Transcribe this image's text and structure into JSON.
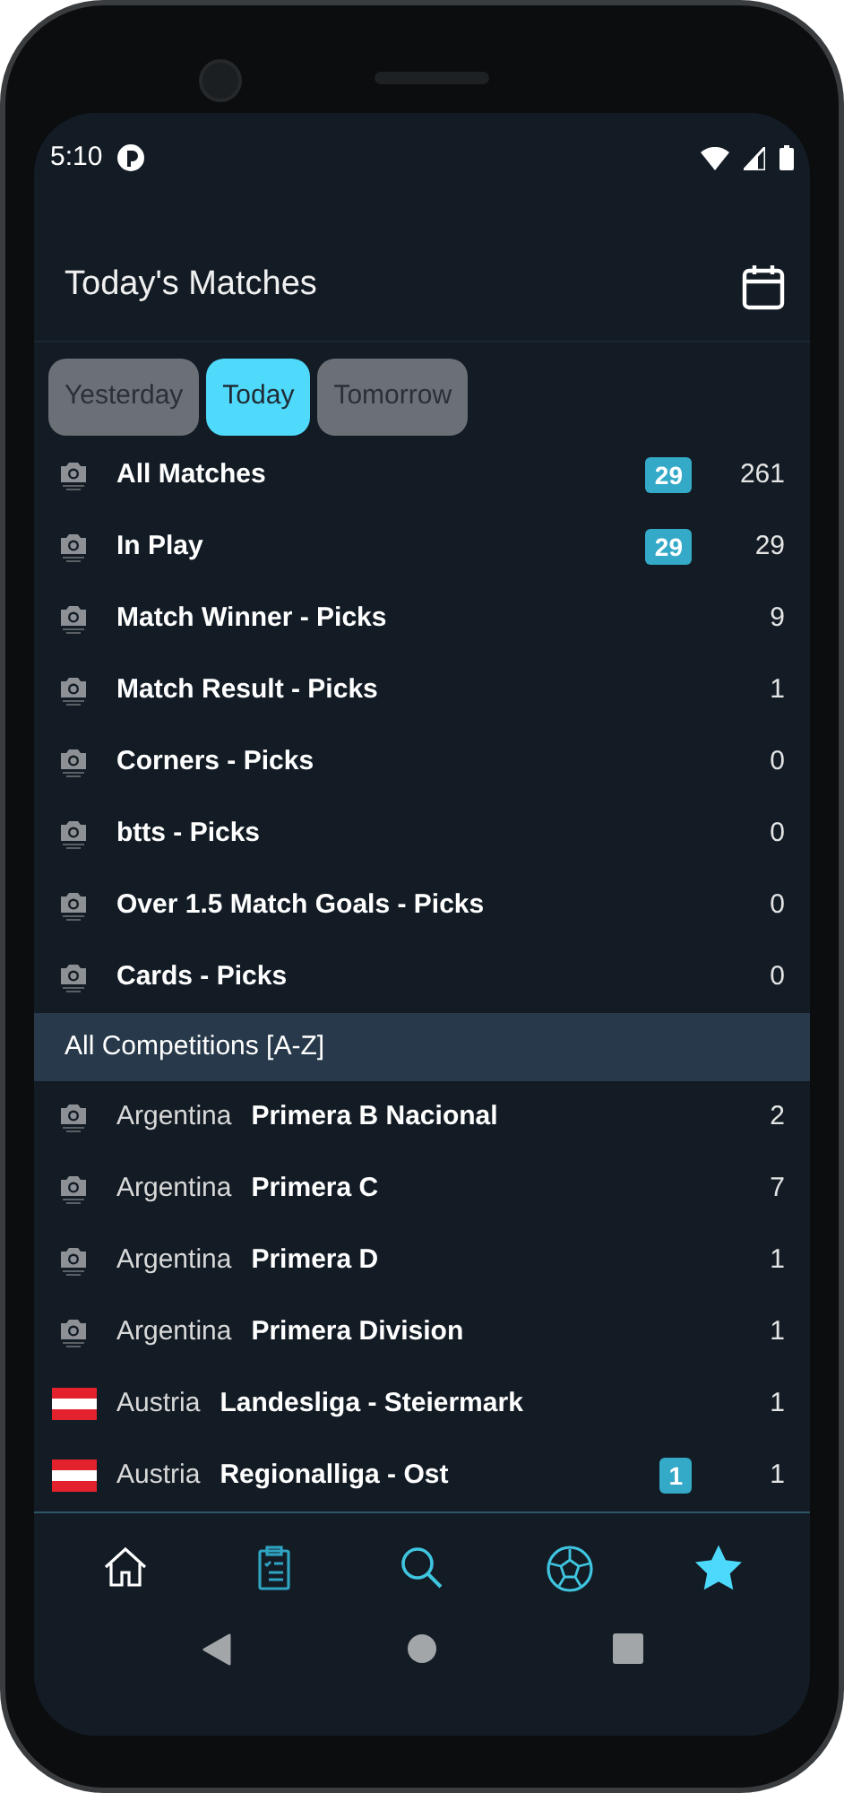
{
  "status_bar": {
    "time": "5:10"
  },
  "header": {
    "title": "Today's Matches"
  },
  "day_tabs": [
    {
      "label": "Yesterday",
      "selected": false
    },
    {
      "label": "Today",
      "selected": true
    },
    {
      "label": "Tomorrow",
      "selected": false
    }
  ],
  "filters": [
    {
      "kind": "placeholder",
      "label": "All Matches",
      "badge": "29",
      "count": "261"
    },
    {
      "kind": "placeholder",
      "label": "In Play",
      "badge": "29",
      "count": "29"
    },
    {
      "kind": "placeholder",
      "label": "Match Winner - Picks",
      "count": "9"
    },
    {
      "kind": "placeholder",
      "label": "Match Result - Picks",
      "count": "1"
    },
    {
      "kind": "placeholder",
      "label": "Corners - Picks",
      "count": "0"
    },
    {
      "kind": "placeholder",
      "label": "btts - Picks",
      "count": "0"
    },
    {
      "kind": "placeholder",
      "label": "Over 1.5 Match Goals - Picks",
      "count": "0"
    },
    {
      "kind": "placeholder",
      "label": "Cards - Picks",
      "count": "0"
    }
  ],
  "section": {
    "title": "All Competitions [A-Z]"
  },
  "competitions": [
    {
      "kind": "placeholder",
      "country": "Argentina",
      "league": "Primera B Nacional",
      "count": "2"
    },
    {
      "kind": "placeholder",
      "country": "Argentina",
      "league": "Primera C",
      "count": "7"
    },
    {
      "kind": "placeholder",
      "country": "Argentina",
      "league": "Primera D",
      "count": "1"
    },
    {
      "kind": "placeholder",
      "country": "Argentina",
      "league": "Primera Division",
      "count": "1"
    },
    {
      "kind": "flag",
      "country": "Austria",
      "league": "Landesliga - Steiermark",
      "count": "1"
    },
    {
      "kind": "flag",
      "country": "Austria",
      "league": "Regionalliga - Ost",
      "badge": "1",
      "count": "1"
    }
  ],
  "bottom_nav": [
    {
      "kind": "home",
      "selected": false,
      "color": "#ffffff"
    },
    {
      "kind": "clipboard",
      "selected": false,
      "color": "#2fa3c1"
    },
    {
      "kind": "search",
      "selected": false,
      "color": "#3fc5e0"
    },
    {
      "kind": "ball",
      "selected": false,
      "color": "#3fc5e0"
    },
    {
      "kind": "star",
      "selected": true,
      "color": "#4dd9fc"
    }
  ]
}
